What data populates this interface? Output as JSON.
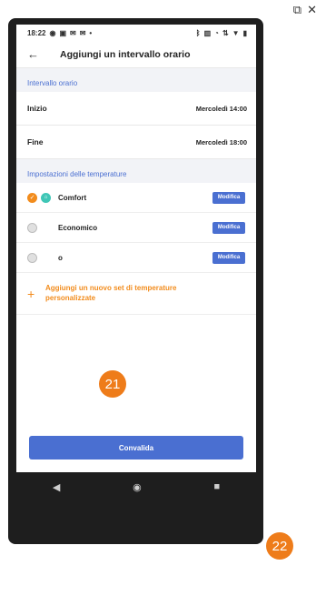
{
  "window_controls": {
    "icons": [
      "external-window-icon",
      "close-icon"
    ],
    "glyphs": [
      "⧉",
      "✕"
    ]
  },
  "status_bar": {
    "time": "18:22",
    "icons_left": [
      "eye-icon",
      "gallery-icon",
      "mail-icon",
      "mail-icon",
      "dot-icon"
    ],
    "icons_right": [
      "bluetooth-icon",
      "vibrate-icon",
      "alarm-icon",
      "signal-icon",
      "wifi-icon",
      "battery-icon"
    ]
  },
  "header": {
    "title": "Aggiungi un intervallo orario",
    "back_glyph": "←"
  },
  "time_interval": {
    "section_label": "Intervallo orario",
    "start_label": "Inizio",
    "start_value": "Mercoledì 14:00",
    "end_label": "Fine",
    "end_value": "Mercoledì 18:00"
  },
  "temperature_settings": {
    "section_label": "Impostazioni delle temperature",
    "items": [
      {
        "name": "Comfort",
        "selected": true,
        "button": "Modifica"
      },
      {
        "name": "Economico",
        "selected": false,
        "button": "Modifica"
      },
      {
        "name": "o",
        "selected": false,
        "button": "Modifica"
      }
    ],
    "add_text": "Aggiungi un nuovo set di temperature personalizzate",
    "add_glyph": "+"
  },
  "footer": {
    "confirm_label": "Convalida"
  },
  "nav": {
    "back": "◀",
    "home": "◉",
    "recent": "■"
  },
  "badges": [
    "21",
    "22"
  ],
  "colors": {
    "accent_blue": "#4a6fd1",
    "accent_orange": "#f28c1d",
    "badge_orange": "#ee7c1a",
    "teal_icon": "#3fc6b6"
  }
}
